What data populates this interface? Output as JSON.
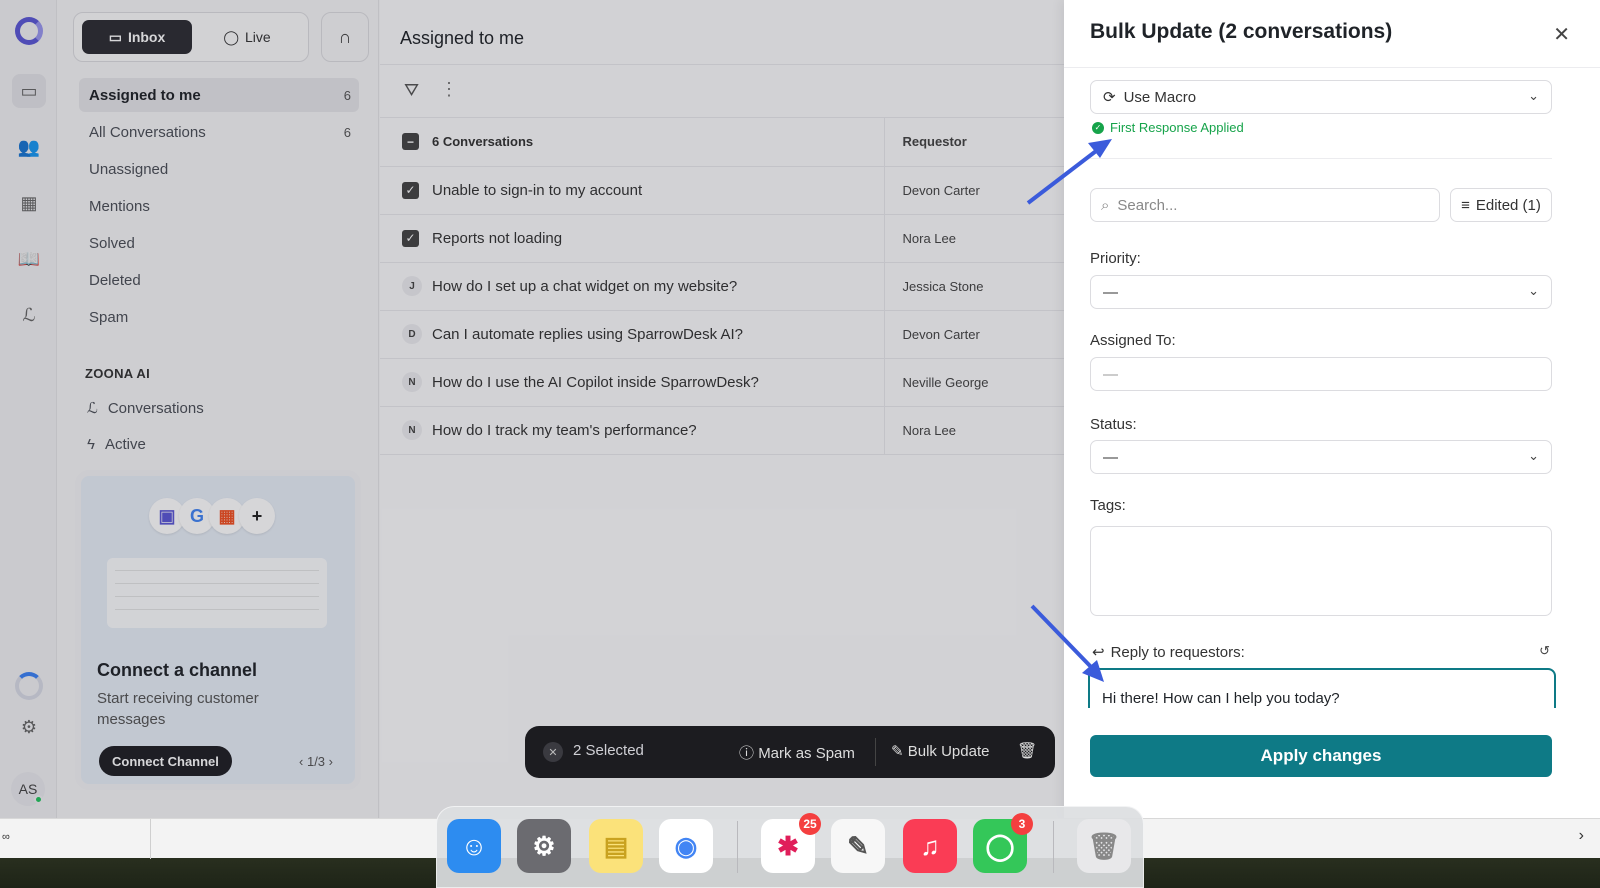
{
  "sidebar": {
    "seg": {
      "inbox": "Inbox",
      "live": "Live"
    },
    "items": [
      {
        "label": "Assigned to me",
        "count": "6"
      },
      {
        "label": "All Conversations",
        "count": "6"
      },
      {
        "label": "Unassigned",
        "count": ""
      },
      {
        "label": "Mentions",
        "count": ""
      },
      {
        "label": "Solved",
        "count": ""
      },
      {
        "label": "Deleted",
        "count": ""
      },
      {
        "label": "Spam",
        "count": ""
      }
    ],
    "ai_heading": "ZOONA AI",
    "ai_items": [
      "Conversations",
      "Active"
    ],
    "card": {
      "title": "Connect a channel",
      "subtitle": "Start receiving customer messages",
      "button": "Connect Channel",
      "pager": "1/3"
    },
    "avatar_initials": "AS"
  },
  "main": {
    "title": "Assigned to me",
    "table": {
      "header_count": "6 Conversations",
      "header_requestor": "Requestor",
      "rows": [
        {
          "mark": "✓",
          "subject": "Unable to sign-in to my account",
          "requestor": "Devon Carter"
        },
        {
          "mark": "✓",
          "subject": "Reports not loading",
          "requestor": "Nora Lee"
        },
        {
          "mark": "J",
          "subject": "How do I set up a chat widget on my website?",
          "requestor": "Jessica Stone"
        },
        {
          "mark": "D",
          "subject": "Can I automate replies using SparrowDesk AI?",
          "requestor": "Devon Carter"
        },
        {
          "mark": "N",
          "subject": "How do I use the AI Copilot inside SparrowDesk?",
          "requestor": "Neville George"
        },
        {
          "mark": "N",
          "subject": "How do I track my team's performance?",
          "requestor": "Nora Lee"
        }
      ]
    }
  },
  "bulkbar": {
    "selected": "2 Selected",
    "spam": "Mark as Spam",
    "update": "Bulk Update"
  },
  "panel": {
    "title": "Bulk Update (2 conversations)",
    "macro": "Use Macro",
    "macro_status": "First Response Applied",
    "search_placeholder": "Search...",
    "edited": "Edited (1)",
    "priority_label": "Priority:",
    "priority_value": "—",
    "assigned_label": "Assigned To:",
    "assigned_value": "—",
    "status_label": "Status:",
    "status_value": "—",
    "tags_label": "Tags:",
    "reply_label": "Reply to requestors:",
    "reply_text": "Hi there! How can I help you today?",
    "apply": "Apply changes"
  },
  "dock": {
    "slack_badge": "25",
    "messages_badge": "3"
  },
  "colors": {
    "accent": "#0e7a86",
    "success": "#16a34a",
    "annotation": "#3b5bdb"
  }
}
